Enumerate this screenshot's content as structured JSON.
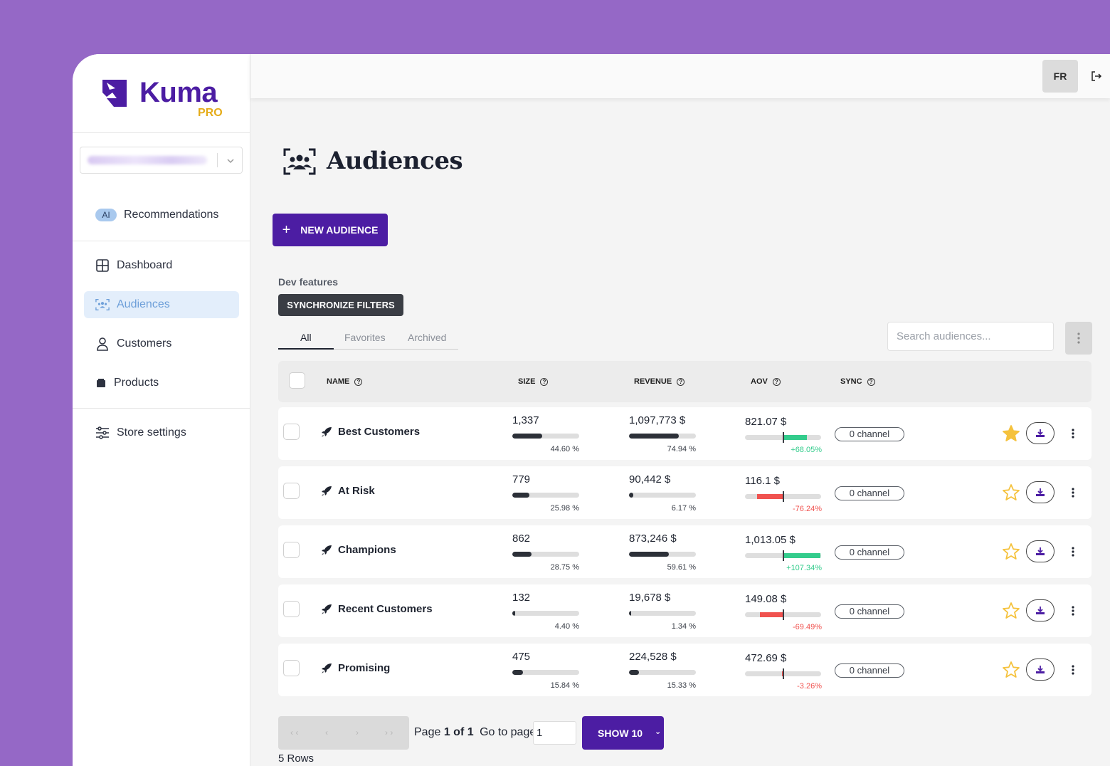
{
  "brand": {
    "name": "Kuma",
    "tier": "PRO"
  },
  "sidebar": {
    "recommendations": {
      "badge": "AI",
      "label": "Recommendations"
    },
    "items": [
      {
        "label": "Dashboard",
        "icon": "grid-icon"
      },
      {
        "label": "Audiences",
        "icon": "audience-icon",
        "active": true
      },
      {
        "label": "Customers",
        "icon": "user-icon"
      },
      {
        "label": "Products",
        "icon": "box-icon"
      }
    ],
    "settings": {
      "label": "Store settings",
      "icon": "sliders-icon"
    }
  },
  "topbar": {
    "language": "FR",
    "logout_icon": "logout-icon"
  },
  "page": {
    "title": "Audiences",
    "new_button": "NEW AUDIENCE",
    "dev_label": "Dev features",
    "sync_button": "SYNCHRONIZE FILTERS",
    "tabs": [
      "All",
      "Favorites",
      "Archived"
    ],
    "search_placeholder": "Search audiences..."
  },
  "table": {
    "columns": [
      "NAME",
      "SIZE",
      "REVENUE",
      "AOV",
      "SYNC"
    ],
    "rows": [
      {
        "name": "Best Customers",
        "size": "1,337",
        "size_pct": "44.60 %",
        "size_frac": 0.446,
        "revenue": "1,097,773 $",
        "revenue_pct": "74.94 %",
        "revenue_frac": 0.7494,
        "aov": "821.07 $",
        "aov_delta": "+68.05%",
        "aov_change": 0.6805,
        "sync": "0 channel",
        "favorite": true
      },
      {
        "name": "At Risk",
        "size": "779",
        "size_pct": "25.98 %",
        "size_frac": 0.2598,
        "revenue": "90,442 $",
        "revenue_pct": "6.17 %",
        "revenue_frac": 0.0617,
        "aov": "116.1 $",
        "aov_delta": "-76.24%",
        "aov_change": -0.7624,
        "sync": "0 channel",
        "favorite": false
      },
      {
        "name": "Champions",
        "size": "862",
        "size_pct": "28.75 %",
        "size_frac": 0.2875,
        "revenue": "873,246 $",
        "revenue_pct": "59.61 %",
        "revenue_frac": 0.5961,
        "aov": "1,013.05 $",
        "aov_delta": "+107.34%",
        "aov_change": 1.0734,
        "sync": "0 channel",
        "favorite": false
      },
      {
        "name": "Recent Customers",
        "size": "132",
        "size_pct": "4.40 %",
        "size_frac": 0.044,
        "revenue": "19,678 $",
        "revenue_pct": "1.34 %",
        "revenue_frac": 0.0134,
        "aov": "149.08 $",
        "aov_delta": "-69.49%",
        "aov_change": -0.6949,
        "sync": "0 channel",
        "favorite": false
      },
      {
        "name": "Promising",
        "size": "475",
        "size_pct": "15.84 %",
        "size_frac": 0.1584,
        "revenue": "224,528 $",
        "revenue_pct": "15.33 %",
        "revenue_frac": 0.1533,
        "aov": "472.69 $",
        "aov_delta": "-3.26%",
        "aov_change": -0.0326,
        "sync": "0 channel",
        "favorite": false
      }
    ]
  },
  "pagination": {
    "first": "« ‹",
    "prev": "‹",
    "next": "›",
    "last": "› ›",
    "page_label": "Page",
    "page_current": "1 of 1",
    "goto_label": "Go to page",
    "goto_value": "1",
    "show_button": "SHOW 10",
    "rows_count": "5 Rows"
  },
  "colors": {
    "primary": "#4c1da3",
    "accent": "#e5ac1a",
    "positive": "#33cc8c",
    "negative": "#f0524f"
  }
}
